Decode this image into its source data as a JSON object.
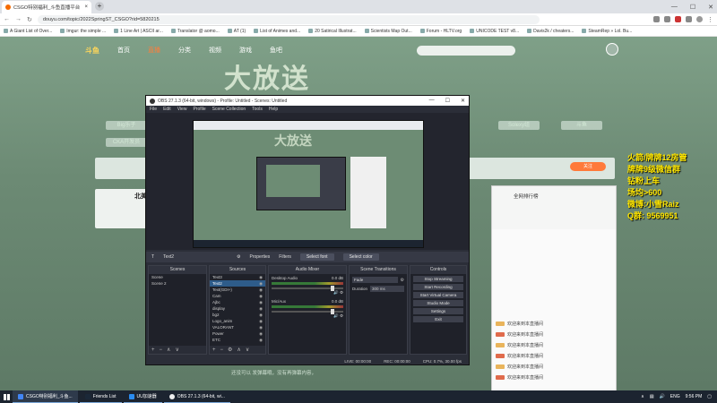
{
  "browser": {
    "tab_title": "CSGO特别福利_斗鱼直播平台",
    "new_tab": "+",
    "window_controls": [
      "—",
      "☐",
      "✕"
    ],
    "url": "douyu.com/topic/2022SpringST_CSGO?rid=5820215",
    "bookmarks": [
      "A Giant List of Over...",
      "Imgur: the simple ...",
      "1 Line Art | ASCII ar...",
      "Translator @ aomo...",
      "AT (1)",
      "List of Animes and...",
      "20 Satirical Illustrat...",
      "Scientists Map Out...",
      "Forum - HLTV.org",
      "UNICODE TEST v8...",
      "Davis2k / cheaters...",
      "SteamRep » Lol. Bu..."
    ]
  },
  "site": {
    "logo": "斗鱼",
    "nav": [
      "首页",
      "直播",
      "分类",
      "视频",
      "游戏",
      "鱼吧"
    ],
    "banner": "大放送",
    "categories": [
      "Big乐子",
      "CKA开发员",
      "Solexy组",
      "斗鱼"
    ],
    "streamer_name": "北美",
    "follow": "关注",
    "foot_text": "还没可以 发弹幕哦，没有再弹幕内容，",
    "chat": {
      "title": "全网排行榜",
      "lines": [
        "欢迎来到本直播间",
        "欢迎来到本直播间",
        "欢迎来到本直播间",
        "欢迎来到本直播间",
        "欢迎来到本直播间",
        "欢迎来到本直播间",
        "欢迎来到本直播间",
        "欢迎来到本直播间"
      ]
    }
  },
  "overlay_text": [
    "火箭/牌牌12房管",
    "牌牌9级微信群",
    "钻粉上车",
    "场均>600",
    "微博:小雪Raiz",
    "Q群: 9569951"
  ],
  "obs": {
    "title": "OBS 27.1.3 (64-bit, windows) - Profile: Untitled - Scenes: Untitled",
    "menu": [
      "File",
      "Edit",
      "View",
      "Profile",
      "Scene Collection",
      "Tools",
      "Help"
    ],
    "source_bar": {
      "source_name": "Text2",
      "properties": "Properties",
      "filters": "Filters",
      "select_font": "Select font",
      "select_color": "Select color"
    },
    "docks": {
      "scenes": {
        "title": "Scenes",
        "items": [
          "Scene",
          "Scene 2"
        ]
      },
      "sources": {
        "title": "Sources",
        "items": [
          "Text3",
          "Text2",
          "Text(GDI+)",
          "Cam",
          "Ajbc",
          "display",
          "bg2",
          "Logo_anim",
          "VALORANT",
          "Power",
          "ETC",
          "Audio",
          "Base"
        ]
      },
      "mixer": {
        "title": "Audio Mixer",
        "channels": [
          {
            "name": "Desktop Audio",
            "db": "0.0 dB"
          },
          {
            "name": "Mic/Aux",
            "db": "0.0 dB"
          }
        ]
      },
      "transitions": {
        "title": "Scene Transitions",
        "type": "Fade",
        "duration_label": "Duration",
        "duration": "300 ms"
      },
      "controls": {
        "title": "Controls",
        "buttons": [
          "Stop Streaming",
          "Start Recording",
          "Start Virtual Camera",
          "Studio Mode",
          "Settings",
          "Exit"
        ]
      }
    },
    "status": [
      "LIVE: 00:00:00",
      "REC: 00:00:00",
      "CPU: 0.7%, 30.00 fps"
    ]
  },
  "taskbar": {
    "tasks": [
      "CSGO特别福利_斗鱼...",
      "Friends List",
      "UU加速器",
      "OBS 27.1.3 (64-bit, wi..."
    ],
    "tray_lang": "ENG",
    "time": "9:56 PM"
  }
}
